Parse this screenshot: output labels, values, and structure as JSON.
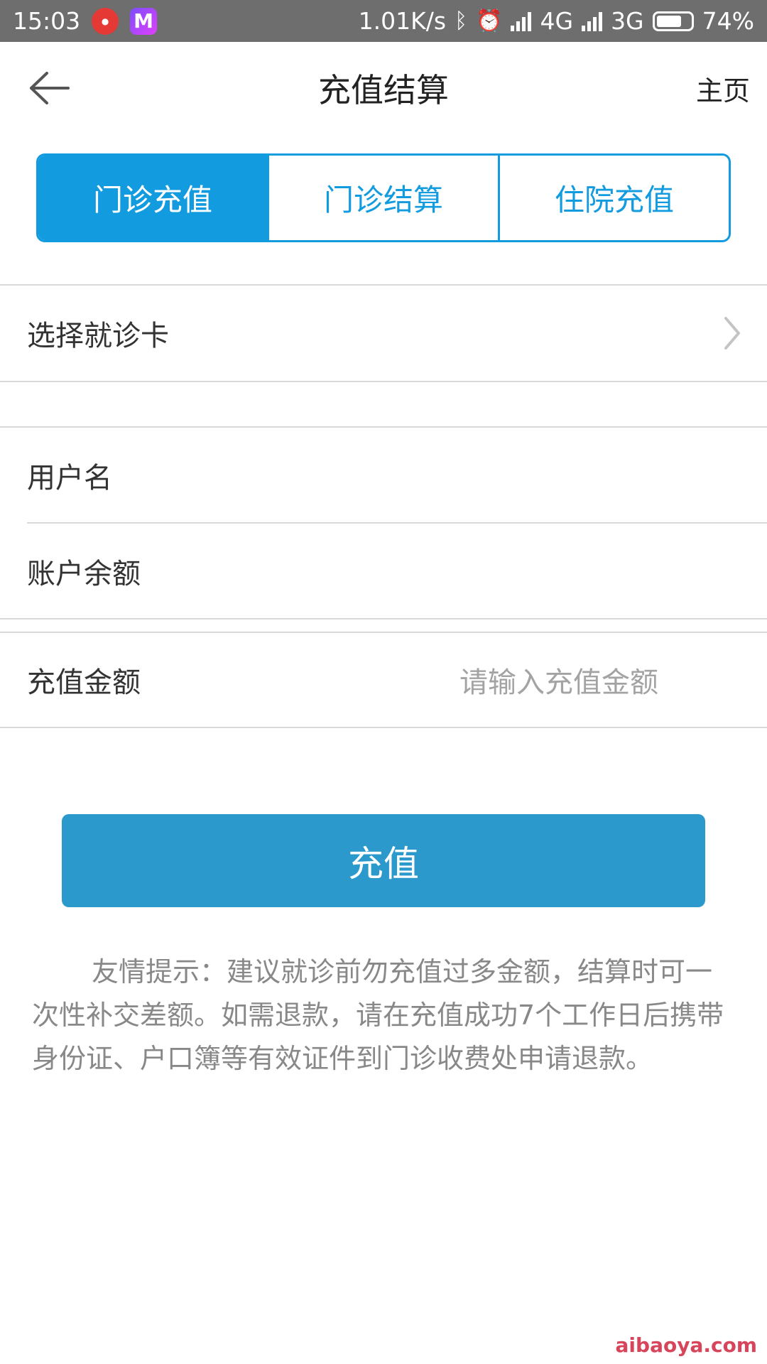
{
  "status_bar": {
    "time": "15:03",
    "network_speed": "1.01K/s",
    "network_1": "4G",
    "network_2": "3G",
    "battery_percent": "74%",
    "battery_level": 0.74
  },
  "header": {
    "title": "充值结算",
    "home_label": "主页"
  },
  "tabs": [
    {
      "label": "门诊充值",
      "active": true
    },
    {
      "label": "门诊结算",
      "active": false
    },
    {
      "label": "住院充值",
      "active": false
    }
  ],
  "form": {
    "select_card_label": "选择就诊卡",
    "username_label": "用户名",
    "balance_label": "账户余额",
    "amount_label": "充值金额",
    "amount_placeholder": "请输入充值金额"
  },
  "submit_label": "充值",
  "tip_text": "友情提示：建议就诊前勿充值过多金额，结算时可一次性补交差额。如需退款，请在充值成功7个工作日后携带身份证、户口簿等有效证件到门诊收费处申请退款。",
  "watermark": "aibaoya.com",
  "colors": {
    "accent": "#139be0",
    "button": "#2b99cc",
    "status_bar": "#6e6e6e"
  }
}
